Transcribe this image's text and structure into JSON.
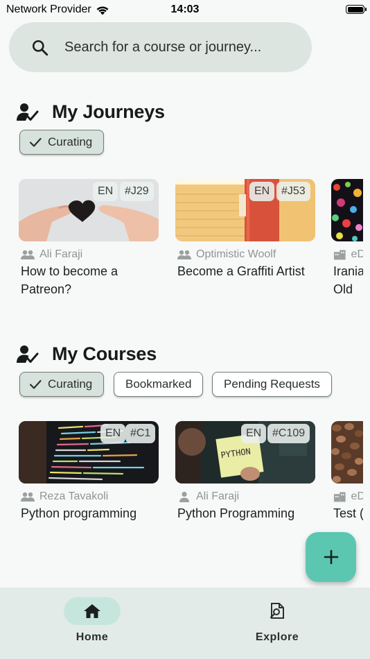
{
  "status_bar": {
    "carrier": "Network Provider",
    "time": "14:03"
  },
  "search": {
    "placeholder": "Search for a course or journey...",
    "icon": "search-icon"
  },
  "journeys": {
    "title": "My Journeys",
    "chips": [
      {
        "label": "Curating",
        "selected": true
      }
    ],
    "cards": [
      {
        "lang": "EN",
        "id": "#J29",
        "author": "Ali Faraji",
        "author_icon": "group-icon",
        "title": "How to become a Patreon?"
      },
      {
        "lang": "EN",
        "id": "#J53",
        "author": "Optimistic Woolf",
        "author_icon": "group-icon",
        "title": "Become a Graffiti Artist"
      },
      {
        "author": "eD",
        "author_icon": "organization-icon",
        "title": "Irania Old"
      }
    ]
  },
  "courses": {
    "title": "My Courses",
    "chips": [
      {
        "label": "Curating",
        "selected": true
      },
      {
        "label": "Bookmarked",
        "selected": false
      },
      {
        "label": "Pending Requests",
        "selected": false
      }
    ],
    "cards": [
      {
        "lang": "EN",
        "id": "#C1",
        "author": "Reza Tavakoli",
        "author_icon": "group-icon",
        "title": "Python programming"
      },
      {
        "lang": "EN",
        "id": "#C109",
        "author": "Ali Faraji",
        "author_icon": "person-icon",
        "title": "Python Programming",
        "thumb_text": "PYTHON"
      },
      {
        "author": "eD",
        "author_icon": "organization-icon",
        "title": "Test ("
      }
    ]
  },
  "fab": {
    "icon": "plus-icon"
  },
  "bottom_nav": [
    {
      "label": "Home",
      "icon": "home-icon",
      "active": true
    },
    {
      "label": "Explore",
      "icon": "explore-icon",
      "active": false
    }
  ],
  "colors": {
    "accent": "#5cc7b1",
    "nav_bg": "#e2ebe7",
    "search_bg": "#dde5e1",
    "active_pill": "#c6e6dd"
  }
}
